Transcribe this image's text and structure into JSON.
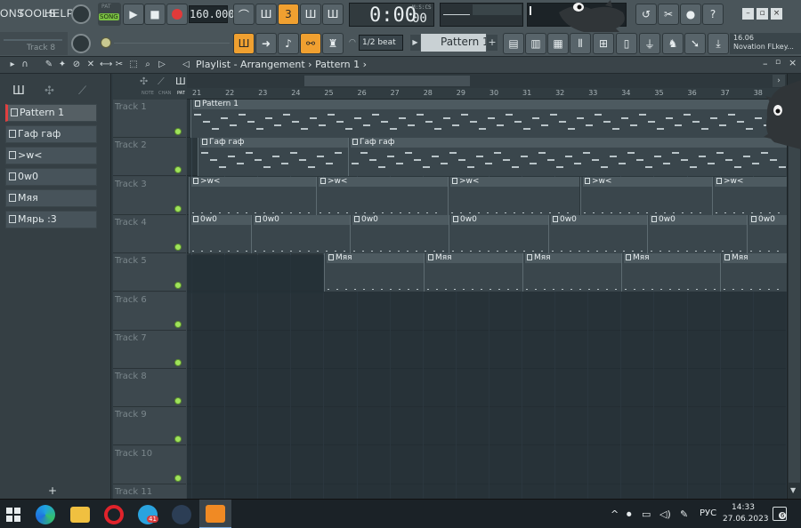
{
  "menu": {
    "items": [
      "ONS",
      "TOOLS",
      "HELP"
    ]
  },
  "transport": {
    "mode_label": "SONG",
    "pat_label": "PAT",
    "tempo": "160.000",
    "time_main": "0:00",
    "time_sub": "00",
    "time_unit": "M:S:CS"
  },
  "hint": {
    "track": "Track 8"
  },
  "snap": {
    "value": "1/2 beat"
  },
  "pattern_selector": {
    "value": "Pattern 1"
  },
  "device": {
    "version": "16.06",
    "name": "Novation FLkey..."
  },
  "playlist": {
    "title": "Playlist - Arrangement",
    "separator": "›",
    "pattern": "Pattern 1",
    "labels": [
      "NOTE",
      "CHAN",
      "PAT"
    ]
  },
  "patterns": [
    "Pattern 1",
    "Гаф гаф",
    ">w<",
    "0w0",
    "Мяя",
    "Мярь :3"
  ],
  "add_label": "+",
  "ruler": [
    "21",
    "22",
    "23",
    "24",
    "25",
    "26",
    "27",
    "28",
    "29",
    "30",
    "31",
    "32",
    "33",
    "34",
    "35",
    "36",
    "37",
    "38"
  ],
  "tracks": [
    "Track 1",
    "Track 2",
    "Track 3",
    "Track 4",
    "Track 5",
    "Track 6",
    "Track 7",
    "Track 8",
    "Track 9",
    "Track 10",
    "Track 11"
  ],
  "clips": {
    "track1": [
      {
        "label": "Pattern 1"
      }
    ],
    "track2": [
      {
        "label": "Гаф гаф"
      },
      {
        "label": "Гаф гаф"
      }
    ],
    "track3": [
      {
        "label": ">w<"
      },
      {
        "label": ">w<"
      },
      {
        "label": ">w<"
      },
      {
        "label": ">w<"
      },
      {
        "label": ">w<"
      }
    ],
    "track4": [
      {
        "label": "0w0"
      },
      {
        "label": "0w0"
      },
      {
        "label": "0w0"
      },
      {
        "label": "0w0"
      },
      {
        "label": "0w0"
      },
      {
        "label": "0w0"
      },
      {
        "label": "0w0"
      }
    ],
    "track5": [
      {
        "label": "Мяя"
      },
      {
        "label": "Мяя"
      },
      {
        "label": "Мяя"
      },
      {
        "label": "Мяя"
      },
      {
        "label": "Мяя"
      }
    ]
  },
  "taskbar": {
    "lang": "РУС",
    "time": "14:33",
    "date": "27.06.2023",
    "notif_count": "6",
    "telegram_badge": "41"
  },
  "colors": {
    "accent": "#f0a030",
    "led": "#9fe35a",
    "song_btn": "#7ac143"
  }
}
